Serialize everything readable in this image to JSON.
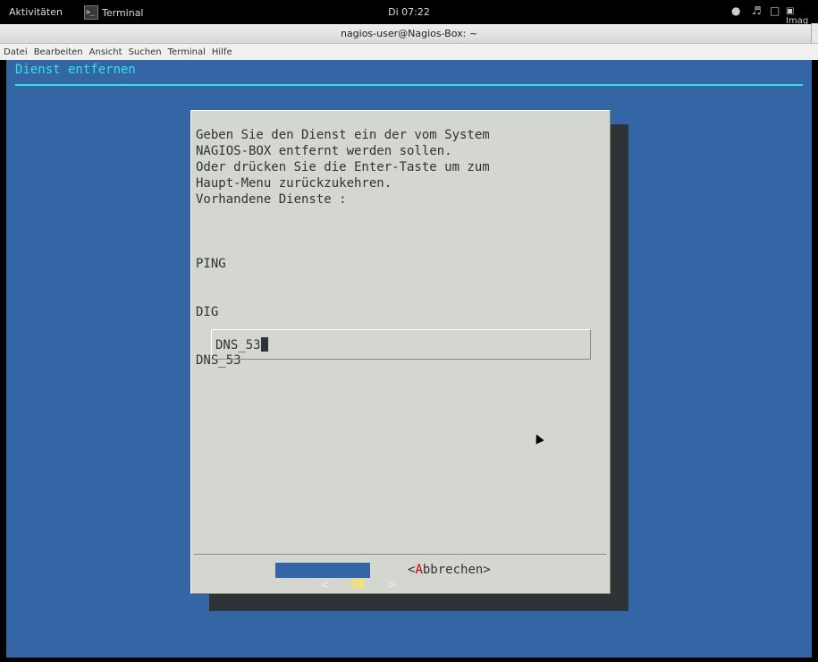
{
  "topbar": {
    "activities": "Aktivitäten",
    "app_name": "Terminal",
    "clock": "Di 07:22",
    "sys_icons": [
      "accessibility-icon",
      "volume-icon",
      "network-icon",
      "image-icon"
    ],
    "tray_label": "Imag"
  },
  "window": {
    "title": "nagios-user@Nagios-Box: ~"
  },
  "menubar": {
    "items": [
      "Datei",
      "Bearbeiten",
      "Ansicht",
      "Suchen",
      "Terminal",
      "Hilfe"
    ]
  },
  "terminal": {
    "header": "Dienst entfernen",
    "colors": {
      "background": "#3465a4",
      "accent": "#34e2e2",
      "dialog": "#d3d7cf"
    }
  },
  "dialog": {
    "message": "Geben Sie den Dienst ein der vom System\nNAGIOS-BOX entfernt werden sollen.\nOder drücken Sie die Enter-Taste um zum\nHaupt-Menu zurückzukehren.\nVorhandene Dienste :",
    "services": [
      "PING",
      "DIG",
      "DNS_53"
    ],
    "input_value": "DNS_53",
    "ok_left": "<",
    "ok_label": "OK",
    "ok_right": ">",
    "cancel_open": "<",
    "cancel_hotkey": "A",
    "cancel_rest": "bbrechen>"
  }
}
